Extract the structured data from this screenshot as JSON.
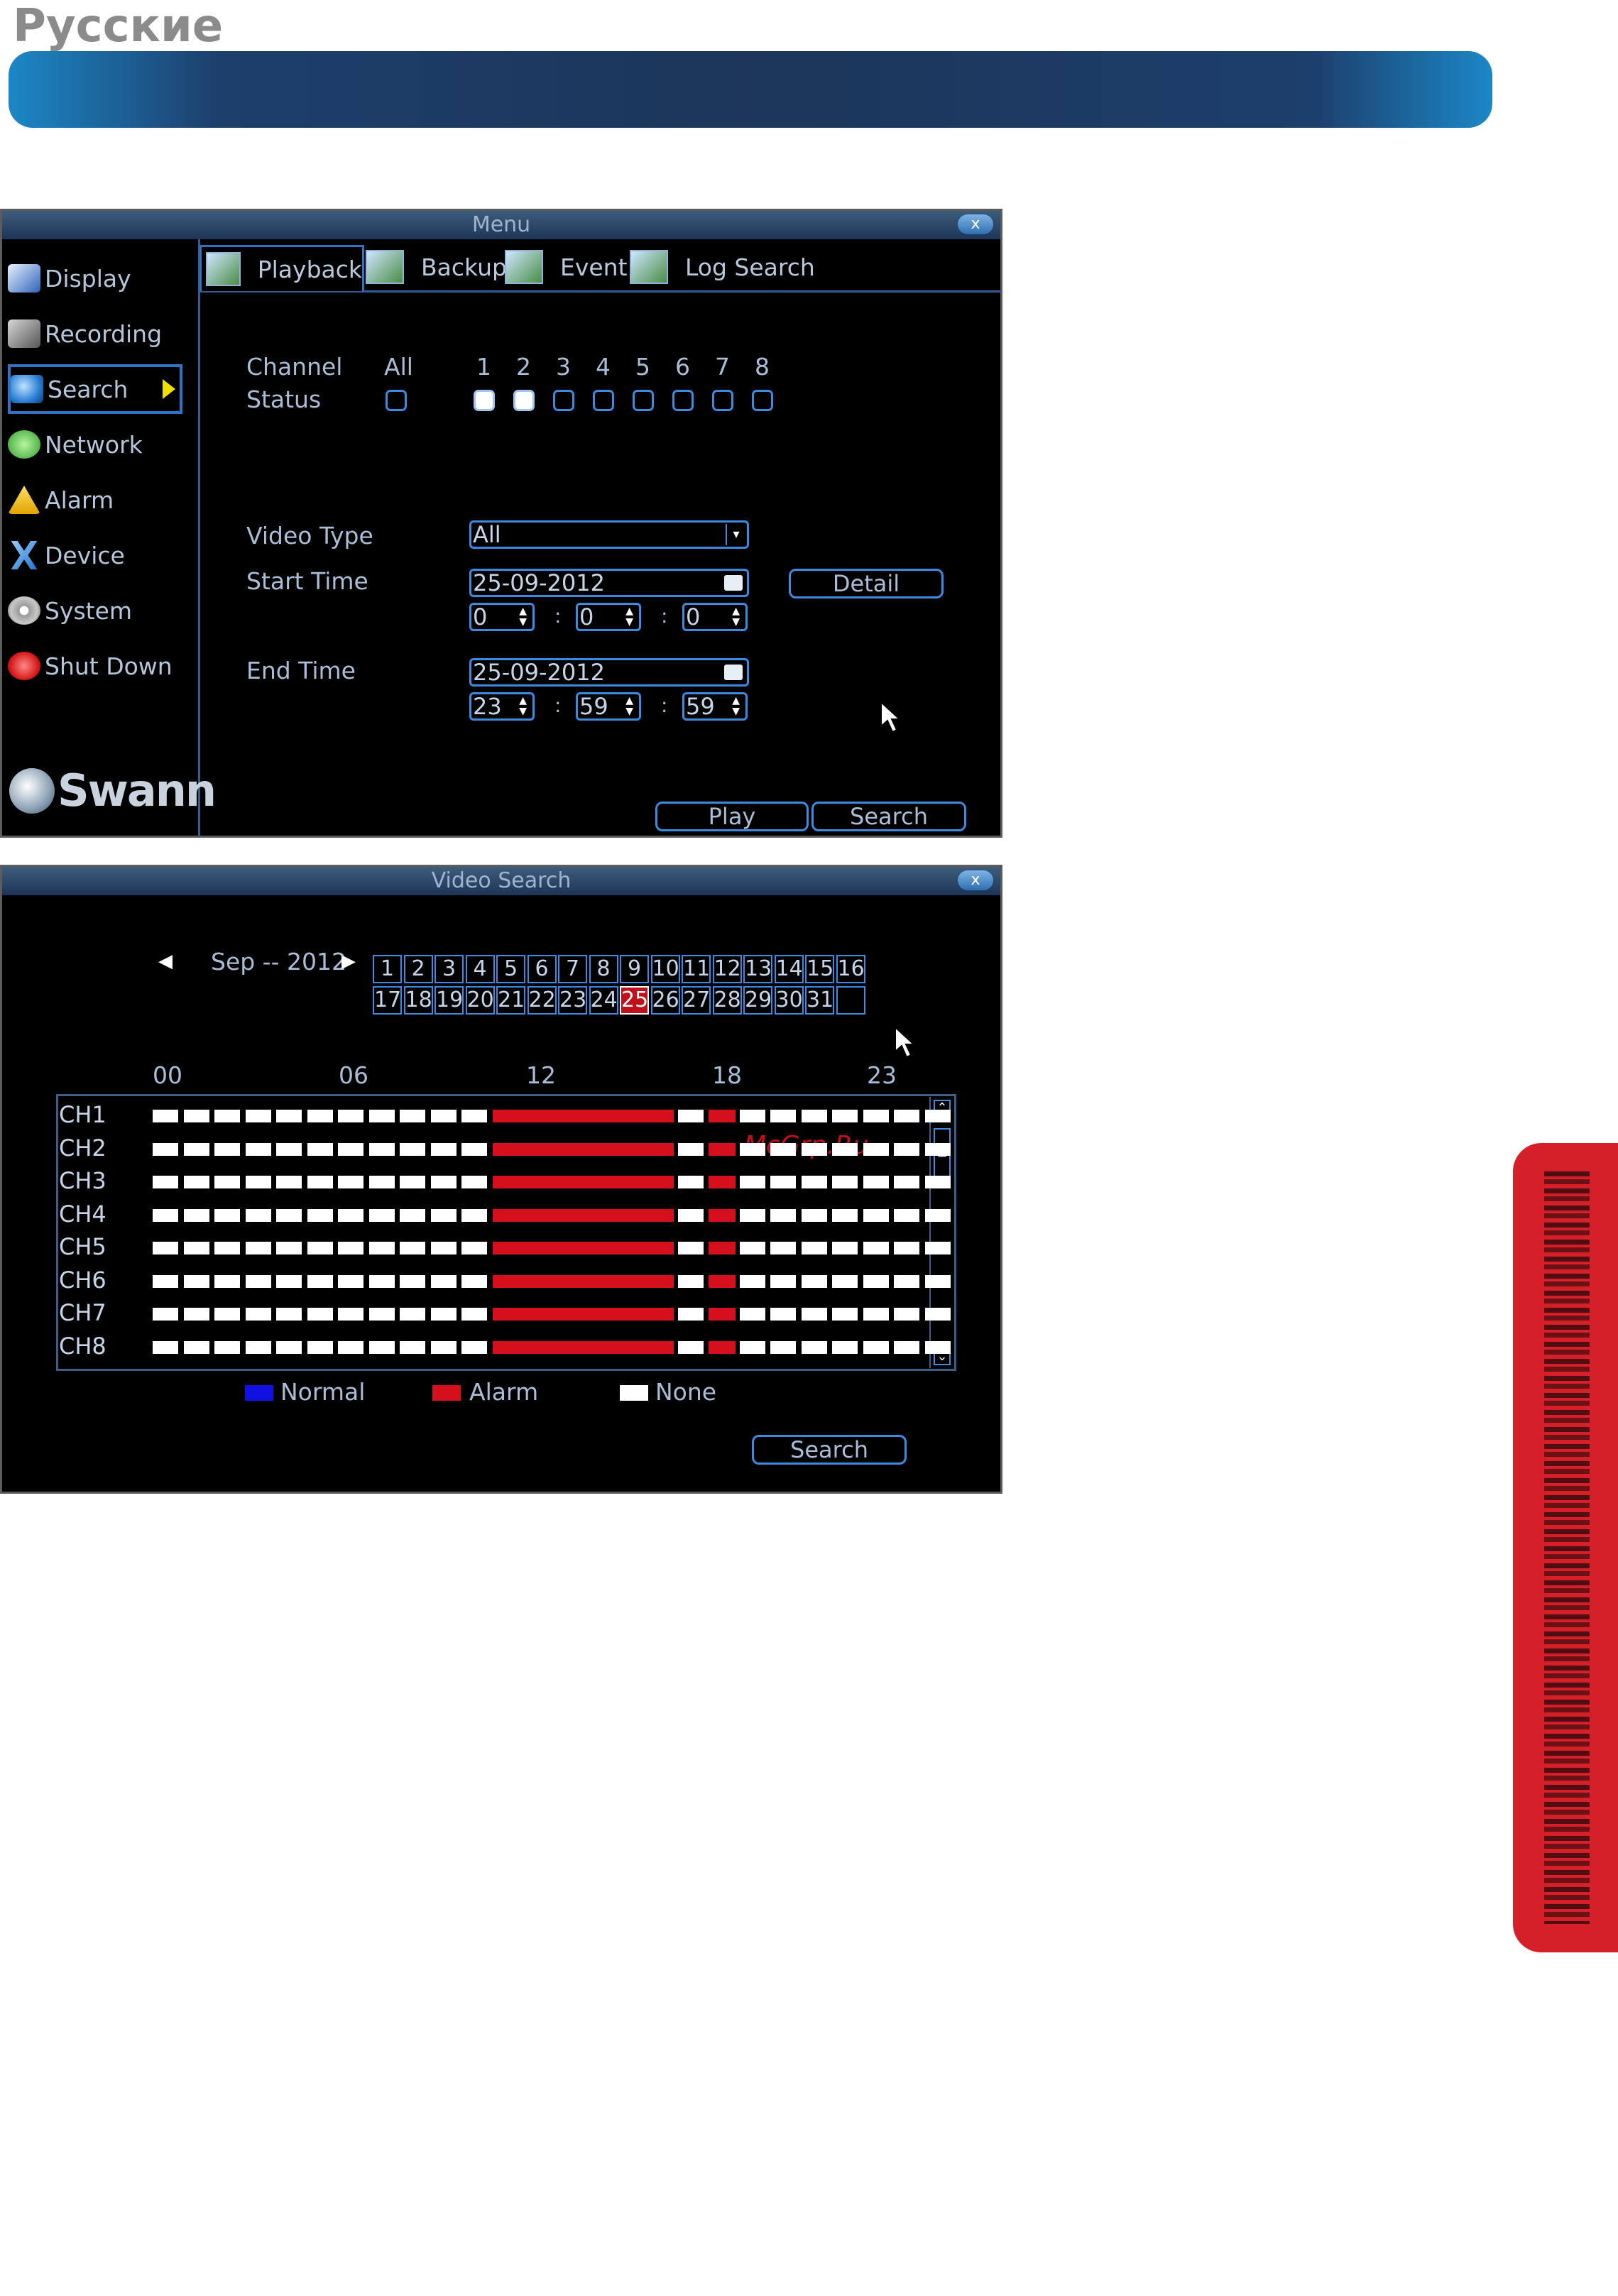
{
  "page": {
    "language_heading": "Русские"
  },
  "menu_window": {
    "title": "Menu",
    "close": "x",
    "sidebar": [
      {
        "label": "Display",
        "icon": "display-icon"
      },
      {
        "label": "Recording",
        "icon": "recording-icon"
      },
      {
        "label": "Search",
        "icon": "search-icon"
      },
      {
        "label": "Network",
        "icon": "network-icon"
      },
      {
        "label": "Alarm",
        "icon": "alarm-icon"
      },
      {
        "label": "Device",
        "icon": "device-icon"
      },
      {
        "label": "System",
        "icon": "system-icon"
      },
      {
        "label": "Shut Down",
        "icon": "power-icon"
      }
    ],
    "logo": "Swann",
    "tabs": [
      "Playback",
      "Backup",
      "Event",
      "Log Search"
    ],
    "channel_label": "Channel",
    "status_label": "Status",
    "all_label": "All",
    "channels": [
      "1",
      "2",
      "3",
      "4",
      "5",
      "6",
      "7",
      "8"
    ],
    "channels_checked": [
      true,
      true,
      false,
      false,
      false,
      false,
      false,
      false
    ],
    "video_type_label": "Video Type",
    "video_type_value": "All",
    "start_time_label": "Start Time",
    "start_date": "25-09-2012",
    "start_h": "0",
    "start_m": "0",
    "start_s": "0",
    "end_time_label": "End Time",
    "end_date": "25-09-2012",
    "end_h": "23",
    "end_m": "59",
    "end_s": "59",
    "colon": ":",
    "detail_button": "Detail",
    "play_button": "Play",
    "search_button": "Search"
  },
  "search_window": {
    "title": "Video Search",
    "close": "x",
    "month_label": "Sep -- 2012",
    "days_row1": [
      "1",
      "2",
      "3",
      "4",
      "5",
      "6",
      "7",
      "8",
      "9",
      "10",
      "11",
      "12",
      "13",
      "14",
      "15",
      "16"
    ],
    "days_row2": [
      "17",
      "18",
      "19",
      "20",
      "21",
      "22",
      "23",
      "24",
      "25",
      "26",
      "27",
      "28",
      "29",
      "30",
      "31",
      ""
    ],
    "selected_day": "25",
    "hour_labels": [
      "00",
      "06",
      "12",
      "18",
      "23"
    ],
    "channels": [
      "CH1",
      "CH2",
      "CH3",
      "CH4",
      "CH5",
      "CH6",
      "CH7",
      "CH8"
    ],
    "slot_pattern": [
      "none",
      "none",
      "none",
      "none",
      "none",
      "none",
      "none",
      "none",
      "none",
      "none",
      "none",
      "alarm",
      "alarm",
      "alarm",
      "alarm",
      "alarm",
      "alarm",
      "none",
      "alarm",
      "none",
      "none",
      "none",
      "none",
      "none",
      "none",
      "none"
    ],
    "legend": [
      {
        "label": "Normal",
        "color": "#1010e0"
      },
      {
        "label": "Alarm",
        "color": "#d4101c"
      },
      {
        "label": "None",
        "color": "#ffffff"
      }
    ],
    "watermark": "McGrp.Ru",
    "search_button": "Search"
  }
}
